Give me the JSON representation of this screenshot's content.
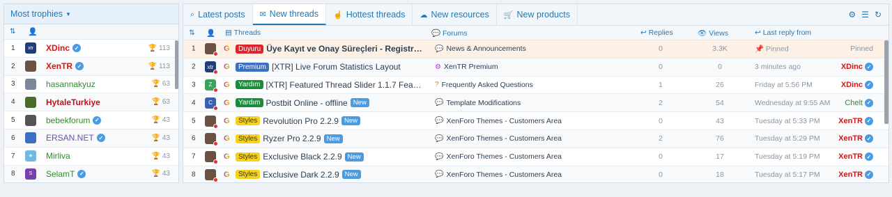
{
  "left": {
    "header": "Most trophies",
    "users": [
      {
        "num": "1",
        "name": "XDinc",
        "color": "#d11",
        "bold": true,
        "verified": true,
        "trophies": "113",
        "av": "#1f3d7a",
        "avtext": "xtr"
      },
      {
        "num": "2",
        "name": "XenTR",
        "color": "#d11",
        "bold": true,
        "verified": true,
        "trophies": "113",
        "av": "#6b5144",
        "avtext": ""
      },
      {
        "num": "3",
        "name": "hasannakyuz",
        "color": "#2a8f2a",
        "bold": false,
        "verified": false,
        "trophies": "63",
        "av": "#7a8899",
        "avtext": ""
      },
      {
        "num": "4",
        "name": "HytaleTurkiye",
        "color": "#c1121f",
        "bold": true,
        "verified": false,
        "trophies": "63",
        "av": "#4a6b2a",
        "avtext": ""
      },
      {
        "num": "5",
        "name": "bebekforum",
        "color": "#2a8f2a",
        "bold": false,
        "verified": true,
        "trophies": "43",
        "av": "#555",
        "avtext": ""
      },
      {
        "num": "6",
        "name": "ERSAN.NET",
        "color": "#6a4fb0",
        "bold": false,
        "verified": true,
        "trophies": "43",
        "av": "#3a70c0",
        "avtext": ""
      },
      {
        "num": "7",
        "name": "Mirliva",
        "color": "#2a8f2a",
        "bold": false,
        "verified": false,
        "trophies": "43",
        "av": "#6fb9e8",
        "avtext": "✷"
      },
      {
        "num": "8",
        "name": "SelamT",
        "color": "#2a8f2a",
        "bold": false,
        "verified": true,
        "trophies": "43",
        "av": "#7b3fb0",
        "avtext": "S"
      }
    ]
  },
  "tabs": [
    {
      "icon": "⌕",
      "label": "Latest posts",
      "active": false
    },
    {
      "icon": "✉",
      "label": "New threads",
      "active": true
    },
    {
      "icon": "☝",
      "label": "Hottest threads",
      "active": false
    },
    {
      "icon": "☁",
      "label": "New resources",
      "active": false
    },
    {
      "icon": "🛒",
      "label": "New products",
      "active": false
    }
  ],
  "columns": {
    "threads": "Threads",
    "forums": "Forums",
    "replies": "Replies",
    "views": "Views",
    "last_reply": "Last reply from"
  },
  "rows": [
    {
      "num": "1",
      "prefix": "Duyuru",
      "pclass": "p-duyuru",
      "title": "Üye Kayıt ve Onay Süreçleri - Registratio...",
      "bold": true,
      "new": false,
      "forum": "News & Announcements",
      "ficon": "💬",
      "fcolor": "#d9262c",
      "replies": "0",
      "views": "3.3K",
      "last": "Pinned",
      "lasticon": "📌",
      "user": "Pinned",
      "ucolor": "#8a96a3",
      "uweight": "normal",
      "verified": false,
      "pinned": true,
      "av": "#6b5144",
      "avtext": ""
    },
    {
      "num": "2",
      "prefix": "Premium",
      "pclass": "p-premium",
      "title": "[XTR] Live Forum Statistics Layout",
      "bold": false,
      "new": false,
      "forum": "XenTR Premium",
      "ficon": "⚙",
      "fcolor": "#b03fd0",
      "replies": "0",
      "views": "0",
      "last": "3 minutes ago",
      "lasticon": "",
      "user": "XDinc",
      "ucolor": "#d11",
      "uweight": "bold",
      "verified": true,
      "pinned": false,
      "av": "#1f3d7a",
      "avtext": "xtr"
    },
    {
      "num": "3",
      "prefix": "Yardım",
      "pclass": "p-yardim",
      "title": "[XTR] Featured Thread Slider 1.1.7 Feature b...",
      "bold": false,
      "new": false,
      "forum": "Frequently Asked Questions",
      "ficon": "?",
      "fcolor": "#e67e22",
      "replies": "1",
      "views": "26",
      "last": "Friday at 5:56 PM",
      "lasticon": "",
      "user": "XDinc",
      "ucolor": "#d11",
      "uweight": "bold",
      "verified": true,
      "pinned": false,
      "av": "#3aa35c",
      "avtext": "Z"
    },
    {
      "num": "4",
      "prefix": "Yardım",
      "pclass": "p-yardim",
      "title": "Postbit Online - offline",
      "bold": false,
      "new": true,
      "forum": "Template Modifications",
      "ficon": "💬",
      "fcolor": "#d9262c",
      "replies": "2",
      "views": "54",
      "last": "Wednesday at 9:55 AM",
      "lasticon": "",
      "user": "Chelt",
      "ucolor": "#2a8f2a",
      "uweight": "normal",
      "verified": true,
      "pinned": false,
      "av": "#3a60b0",
      "avtext": "C"
    },
    {
      "num": "5",
      "prefix": "Styles",
      "pclass": "p-styles",
      "title": "Revolution Pro 2.2.9",
      "bold": false,
      "new": true,
      "forum": "XenForo Themes - Customers Area",
      "ficon": "💬",
      "fcolor": "#d9262c",
      "replies": "0",
      "views": "43",
      "last": "Tuesday at 5:33 PM",
      "lasticon": "",
      "user": "XenTR",
      "ucolor": "#d11",
      "uweight": "bold",
      "verified": true,
      "pinned": false,
      "av": "#6b5144",
      "avtext": ""
    },
    {
      "num": "6",
      "prefix": "Styles",
      "pclass": "p-styles",
      "title": "Ryzer Pro 2.2.9",
      "bold": false,
      "new": true,
      "forum": "XenForo Themes - Customers Area",
      "ficon": "💬",
      "fcolor": "#d9262c",
      "replies": "2",
      "views": "76",
      "last": "Tuesday at 5:29 PM",
      "lasticon": "",
      "user": "XenTR",
      "ucolor": "#d11",
      "uweight": "bold",
      "verified": true,
      "pinned": false,
      "av": "#6b5144",
      "avtext": ""
    },
    {
      "num": "7",
      "prefix": "Styles",
      "pclass": "p-styles",
      "title": "Exclusive Black 2.2.9",
      "bold": false,
      "new": true,
      "forum": "XenForo Themes - Customers Area",
      "ficon": "💬",
      "fcolor": "#d9262c",
      "replies": "0",
      "views": "17",
      "last": "Tuesday at 5:19 PM",
      "lasticon": "",
      "user": "XenTR",
      "ucolor": "#d11",
      "uweight": "bold",
      "verified": true,
      "pinned": false,
      "av": "#6b5144",
      "avtext": ""
    },
    {
      "num": "8",
      "prefix": "Styles",
      "pclass": "p-styles",
      "title": "Exclusive Dark 2.2.9",
      "bold": false,
      "new": true,
      "forum": "XenForo Themes - Customers Area",
      "ficon": "💬",
      "fcolor": "#d9262c",
      "replies": "0",
      "views": "18",
      "last": "Tuesday at 5:17 PM",
      "lasticon": "",
      "user": "XenTR",
      "ucolor": "#d11",
      "uweight": "bold",
      "verified": true,
      "pinned": false,
      "av": "#6b5144",
      "avtext": ""
    }
  ],
  "new_label": "New",
  "google_label": "G"
}
